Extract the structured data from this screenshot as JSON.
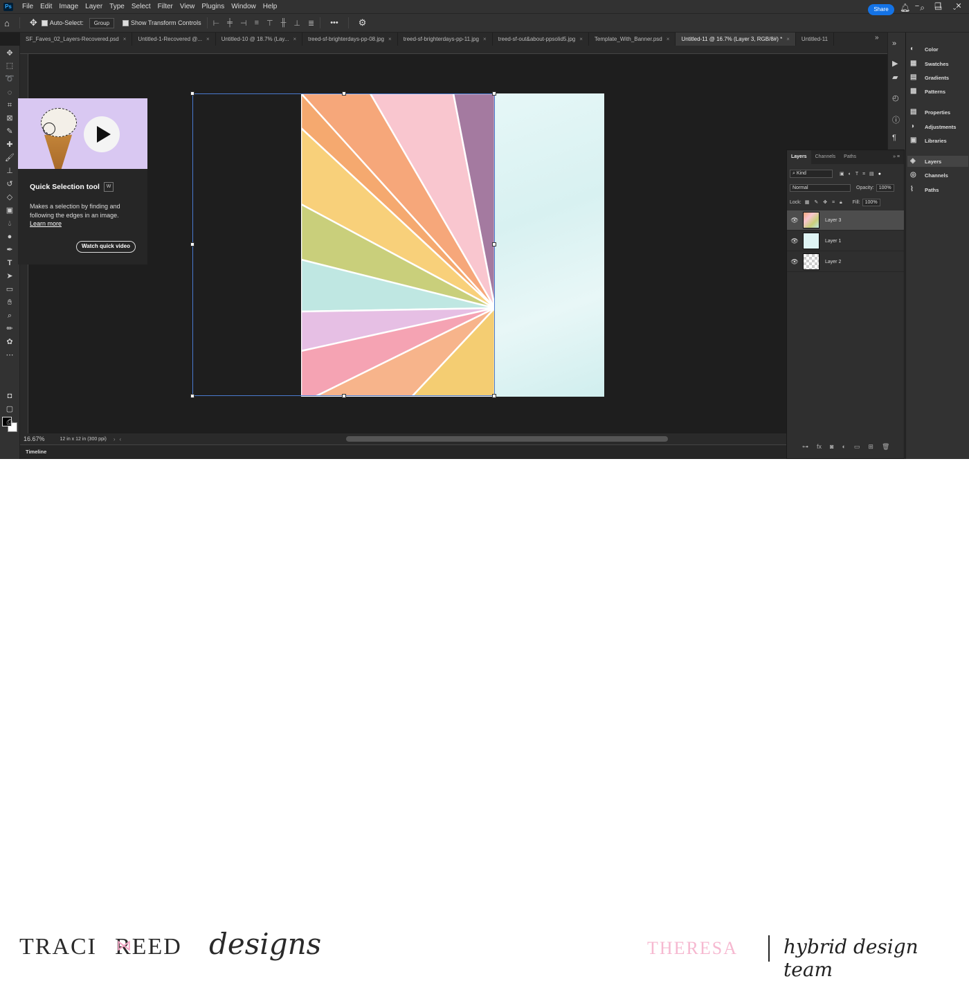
{
  "menubar": {
    "app_icon": "Ps",
    "items": [
      "File",
      "Edit",
      "Image",
      "Layer",
      "Type",
      "Select",
      "Filter",
      "View",
      "Plugins",
      "Window",
      "Help"
    ],
    "controls": [
      "−",
      "❐",
      "✕"
    ]
  },
  "options": {
    "auto_select_label": "Auto-Select:",
    "group_value": "Group",
    "transform_label": "Show Transform Controls",
    "more": "•••",
    "share": "Share"
  },
  "tabs": [
    {
      "label": "SF_Faves_02_Layers-Recovered.psd",
      "close": "×"
    },
    {
      "label": "Untitled-1-Recovered @...",
      "close": "×"
    },
    {
      "label": "Untitled-10 @ 18.7% (Lay...",
      "close": "×"
    },
    {
      "label": "treed-sf-brighterdays-pp-08.jpg",
      "close": "×"
    },
    {
      "label": "treed-sf-brighterdays-pp-11.jpg",
      "close": "×"
    },
    {
      "label": "treed-sf-out&about-ppsolid5.jpg",
      "close": "×"
    },
    {
      "label": "Template_With_Banner.psd",
      "close": "×"
    },
    {
      "label": "Untitled-11 @ 16.7% (Layer 3, RGB/8#) *",
      "close": "×"
    },
    {
      "label": "Untitled-11",
      "close": ""
    }
  ],
  "tabs_more": "»",
  "tooltip": {
    "title": "Quick Selection tool",
    "shortcut": "W",
    "description": "Makes a selection by finding and following the edges in an image.",
    "link": "Learn more",
    "button": "Watch quick video"
  },
  "panels": {
    "items": [
      "Color",
      "Swatches",
      "Gradients",
      "Patterns",
      "Properties",
      "Adjustments",
      "Libraries",
      "Layers",
      "Channels",
      "Paths"
    ]
  },
  "layers_panel": {
    "tabs": [
      "Layers",
      "Channels",
      "Paths"
    ],
    "filter": "Kind",
    "blend_mode": "Normal",
    "opacity_label": "Opacity:",
    "opacity_value": "100%",
    "lock_label": "Lock:",
    "fill_label": "Fill:",
    "fill_value": "100%",
    "layers": [
      {
        "name": "Layer 3",
        "selected": true
      },
      {
        "name": "Layer 1",
        "selected": false
      },
      {
        "name": "Layer 2",
        "selected": false
      }
    ],
    "footer_icons": [
      "link-icon",
      "fx-icon",
      "mask-icon",
      "adjustment-icon",
      "folder-icon",
      "new-layer-icon",
      "trash-icon"
    ]
  },
  "status": {
    "zoom": "16.67%",
    "doc_size": "12 in x 12 in (300 ppi)"
  },
  "timeline_label": "Timeline",
  "footer": {
    "brand_left": "TRACI",
    "brand_right": "REED",
    "brand_script": "designs",
    "name": "THERESA",
    "team": "hybrid design team"
  },
  "colors": {
    "accent": "#1473e6",
    "panel_bg": "#323232",
    "canvas_bg": "#1e1e1e",
    "name_pink": "#f6b8d0"
  }
}
